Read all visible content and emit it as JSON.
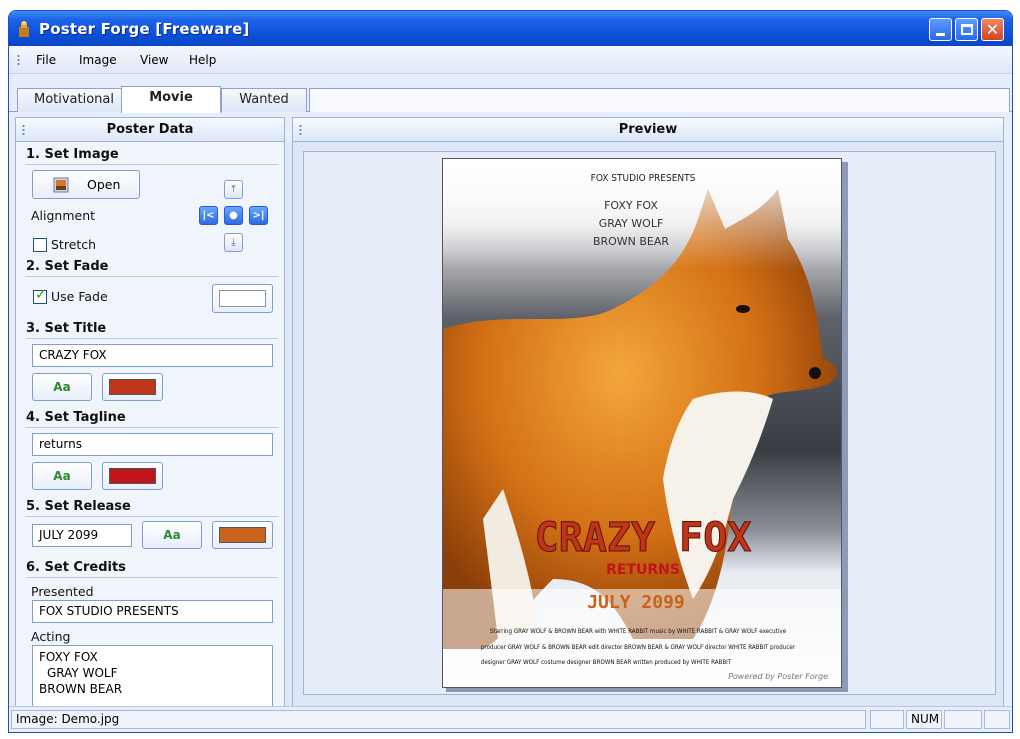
{
  "window": {
    "title": "Poster Forge [Freeware]"
  },
  "menu": [
    "File",
    "Image",
    "View",
    "Help"
  ],
  "tabs": [
    "Motivational",
    "Movie",
    "Wanted"
  ],
  "left_panel": {
    "header": "Poster Data",
    "set_image": {
      "title": "1. Set Image",
      "open_label": "Open",
      "alignment_label": "Alignment",
      "stretch_label": "Stretch",
      "stretch_checked": false
    },
    "set_fade": {
      "title": "2. Set Fade",
      "use_fade_label": "Use Fade",
      "use_fade_checked": true,
      "fade_color": "#ffffff"
    },
    "set_title": {
      "title": "3. Set Title",
      "value": "CRAZY FOX",
      "font_label": "Aa",
      "color": "#c0341a"
    },
    "set_tagline": {
      "title": "4. Set Tagline",
      "value": "returns",
      "font_label": "Aa",
      "color": "#c0141a"
    },
    "set_release": {
      "title": "5. Set Release",
      "value": "JULY 2099",
      "font_label": "Aa",
      "color": "#c8631e"
    },
    "set_credits": {
      "title": "6. Set Credits",
      "presented_label": "Presented",
      "presented_value": "FOX STUDIO PRESENTS",
      "acting_label": "Acting",
      "acting_lines": [
        "FOXY FOX",
        "GRAY WOLF",
        "BROWN BEAR"
      ]
    }
  },
  "preview": {
    "header": "Preview",
    "poster": {
      "presents": "FOX STUDIO PRESENTS",
      "cast": [
        "FOXY FOX",
        "GRAY WOLF",
        "BROWN BEAR"
      ],
      "title": "CRAZY FOX",
      "tagline": "RETURNS",
      "release": "JULY 2099",
      "credits": [
        "Starring GRAY WOLF & BROWN BEAR with WHITE RABBIT music by WHITE RABBIT & GRAY WOLF executive",
        "producer GRAY WOLF & BROWN BEAR edit director BROWN BEAR & GRAY WOLF director WHITE RABBIT producer",
        "designer GRAY WOLF costume designer BROWN BEAR written produced by WHITE RABBIT"
      ],
      "powered_by": "Powered by Poster Forge"
    }
  },
  "statusbar": {
    "image": "Image: Demo.jpg",
    "num": "NUM"
  }
}
